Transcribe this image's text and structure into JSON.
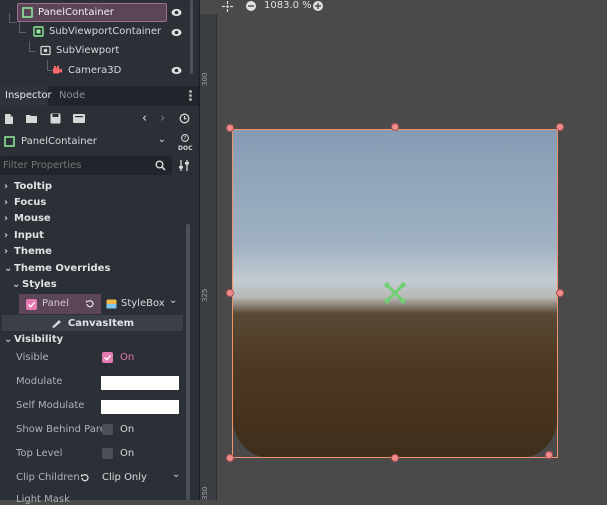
{
  "scene_tree": {
    "nodes": [
      {
        "label": "PanelContainer",
        "icon": "panel-container-icon",
        "visible": true,
        "selected": true
      },
      {
        "label": "SubViewportContainer",
        "icon": "subviewport-container-icon",
        "visible": true
      },
      {
        "label": "SubViewport",
        "icon": "subviewport-icon",
        "visible": false
      },
      {
        "label": "Camera3D",
        "icon": "camera3d-icon",
        "visible": true
      }
    ]
  },
  "inspector": {
    "tabs": [
      {
        "label": "Inspector",
        "active": true
      },
      {
        "label": "Node",
        "active": false
      }
    ],
    "object_selector": "PanelContainer",
    "doc_label": "DOC",
    "filter_placeholder": "Filter Properties",
    "sections": {
      "tooltip": "Tooltip",
      "focus": "Focus",
      "mouse": "Mouse",
      "input": "Input",
      "theme": "Theme",
      "theme_overrides": "Theme Overrides",
      "styles": "Styles",
      "canvas_item": "CanvasItem",
      "visibility": "Visibility"
    },
    "panel_override": {
      "label": "Panel",
      "value": "StyleBox"
    },
    "properties": {
      "visible": {
        "label": "Visible",
        "value": "On"
      },
      "modulate": {
        "label": "Modulate",
        "color": "#ffffff"
      },
      "self_modulate": {
        "label": "Self Modulate",
        "color": "#ffffff"
      },
      "show_behind_parent": {
        "label": "Show Behind Pare",
        "value": "On"
      },
      "top_level": {
        "label": "Top Level",
        "value": "On"
      },
      "clip_children": {
        "label": "Clip Children",
        "value": "Clip Only"
      },
      "light_mask": {
        "label": "Light Mask"
      }
    }
  },
  "viewport": {
    "zoom": "1083.0 %",
    "ruler_marks": [
      "300",
      "325",
      "350"
    ]
  },
  "colors": {
    "accent_pink": "#e57ab3",
    "selection_orange": "#f0926a",
    "panel_bg": "#2b2f36"
  }
}
